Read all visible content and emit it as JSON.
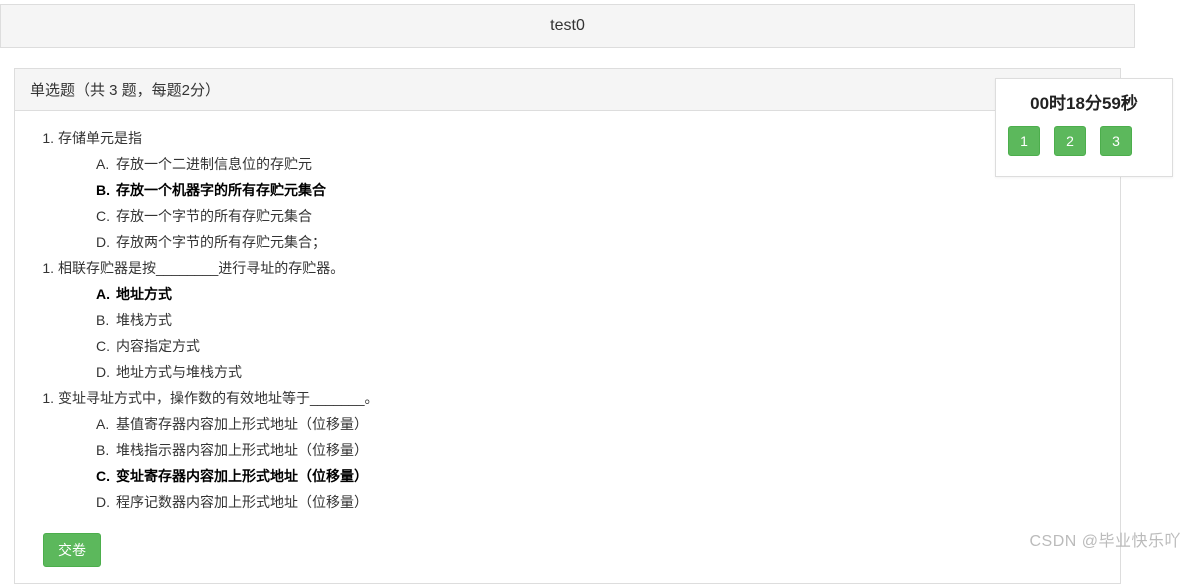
{
  "header": {
    "title": "test0"
  },
  "section": {
    "heading": "单选题（共 3 题，每题2分）"
  },
  "questions": [
    {
      "number": "1.",
      "stem": "存储单元是指",
      "selected_index": 1,
      "options": [
        {
          "letter": "A.",
          "text": "存放一个二进制信息位的存贮元"
        },
        {
          "letter": "B.",
          "text": "存放一个机器字的所有存贮元集合"
        },
        {
          "letter": "C.",
          "text": "存放一个字节的所有存贮元集合"
        },
        {
          "letter": "D.",
          "text": "存放两个字节的所有存贮元集合；"
        }
      ]
    },
    {
      "number": "1.",
      "stem": "相联存贮器是按________进行寻址的存贮器。",
      "selected_index": 0,
      "options": [
        {
          "letter": "A.",
          "text": "地址方式"
        },
        {
          "letter": "B.",
          "text": "堆栈方式"
        },
        {
          "letter": "C.",
          "text": "内容指定方式"
        },
        {
          "letter": "D.",
          "text": "地址方式与堆栈方式"
        }
      ]
    },
    {
      "number": "1.",
      "stem": "变址寻址方式中，操作数的有效地址等于_______。",
      "selected_index": 2,
      "options": [
        {
          "letter": "A.",
          "text": "基值寄存器内容加上形式地址（位移量）"
        },
        {
          "letter": "B.",
          "text": "堆栈指示器内容加上形式地址（位移量）"
        },
        {
          "letter": "C.",
          "text": "变址寄存器内容加上形式地址（位移量）"
        },
        {
          "letter": "D.",
          "text": "程序记数器内容加上形式地址（位移量）"
        }
      ]
    }
  ],
  "submit": {
    "label": "交卷"
  },
  "side": {
    "timer": "00时18分59秒",
    "nav": [
      "1",
      "2",
      "3"
    ]
  },
  "watermark": "CSDN @毕业快乐吖"
}
